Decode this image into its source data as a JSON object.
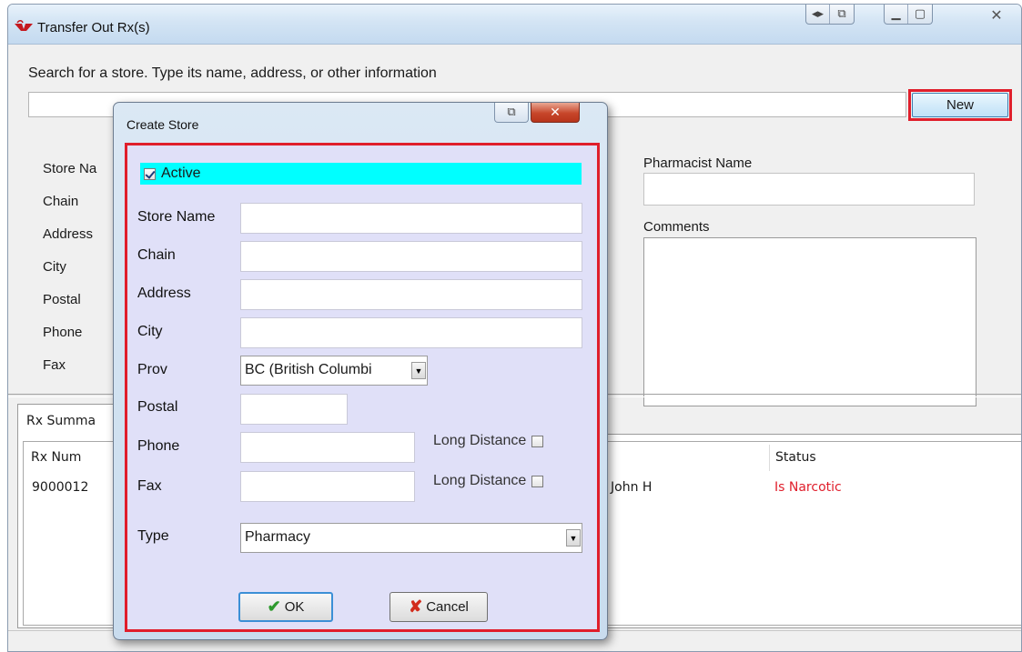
{
  "window": {
    "title": "Transfer Out Rx(s)"
  },
  "search": {
    "label": "Search for a store.  Type its name, address, or other information",
    "value": "",
    "new_label": "New"
  },
  "store_form": {
    "labels": [
      "Store Na",
      "Chain",
      "Address",
      "City",
      "Postal",
      "Phone",
      "Fax"
    ],
    "pharmacist_label": "Pharmacist Name",
    "comments_label": "Comments"
  },
  "tabs": {
    "rx_summary": "Rx Summa"
  },
  "grid": {
    "headers": {
      "rx_num": "Rx Num",
      "status": "Status"
    },
    "rows": [
      {
        "rx_num": "9000012",
        "name": "John H",
        "status": "Is Narcotic"
      }
    ],
    "status_color": "#e01e2b"
  },
  "dialog": {
    "title": "Create Store",
    "active_label": "Active",
    "active_checked": true,
    "fields": {
      "store_name": "Store Name",
      "chain": "Chain",
      "address": "Address",
      "city": "City",
      "prov": "Prov",
      "postal": "Postal",
      "phone": "Phone",
      "fax": "Fax",
      "type": "Type"
    },
    "prov_value": "BC (British Columbi",
    "type_value": "Pharmacy",
    "long_distance_label": "Long Distance",
    "ok_label": "OK",
    "cancel_label": "Cancel"
  },
  "colors": {
    "highlight_outline": "#e01e2b",
    "active_bar": "#00ffff",
    "dialog_body": "#e0e0f8"
  }
}
